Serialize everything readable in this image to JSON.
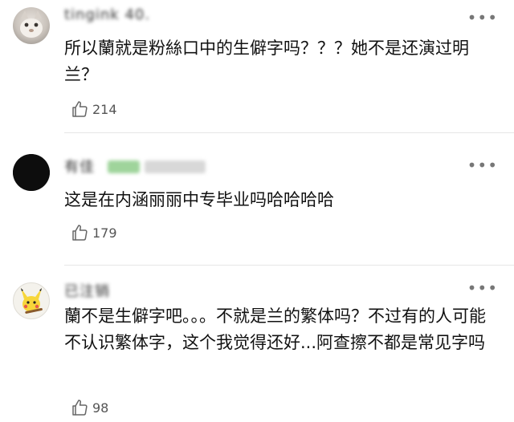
{
  "comments": [
    {
      "username": "tingink  40.",
      "text": "所以蘭就是粉絲口中的生僻字吗？？？她不是还演过明兰？",
      "likes": "214",
      "avatar_icon": "cat-photo-icon"
    },
    {
      "username": "有佳",
      "text": "这是在内涵丽丽中专毕业吗哈哈哈哈",
      "likes": "179",
      "avatar_icon": "black-circle-icon"
    },
    {
      "username": "已注销",
      "text": "蘭不是生僻字吧。。。不就是兰的繁体吗？不过有的人可能不认识繁体字，这个我觉得还好...阿查擦不都是常见字吗",
      "likes": "98",
      "avatar_icon": "pikachu-icon"
    }
  ],
  "more_label": "•••",
  "colors": {
    "divider": "#e6e6e6",
    "text": "#111111",
    "meta": "#555555"
  }
}
